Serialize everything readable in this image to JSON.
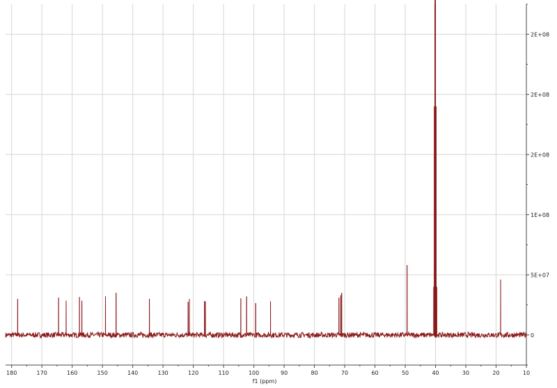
{
  "chart_data": {
    "type": "line",
    "title": "",
    "xlabel": "f1 (ppm)",
    "ylabel": "",
    "xlim": [
      182,
      10
    ],
    "ylim": [
      -25000000,
      275000000
    ],
    "x_reversed": true,
    "grid": true,
    "x_ticks": [
      180,
      170,
      160,
      150,
      140,
      130,
      120,
      110,
      100,
      90,
      80,
      70,
      60,
      50,
      40,
      30,
      20,
      10
    ],
    "y_ticks": [
      {
        "value": 0,
        "label": "0"
      },
      {
        "value": 50000000,
        "label": "5E+07"
      },
      {
        "value": 100000000,
        "label": "1E+08"
      },
      {
        "value": 150000000,
        "label": "2E+08"
      },
      {
        "value": 200000000,
        "label": "2E+08"
      },
      {
        "value": 250000000,
        "label": "2E+08"
      }
    ],
    "line_color": "#8b1a1a",
    "series": [
      {
        "peaks": [
          {
            "x": 178.0,
            "y": 30000000
          },
          {
            "x": 164.5,
            "y": 31000000
          },
          {
            "x": 162.0,
            "y": 28500000
          },
          {
            "x": 157.6,
            "y": 31500000
          },
          {
            "x": 156.8,
            "y": 28500000
          },
          {
            "x": 149.0,
            "y": 32000000
          },
          {
            "x": 145.5,
            "y": 35000000
          },
          {
            "x": 134.5,
            "y": 30000000
          },
          {
            "x": 121.7,
            "y": 27500000
          },
          {
            "x": 121.3,
            "y": 30000000
          },
          {
            "x": 116.3,
            "y": 28000000
          },
          {
            "x": 116.0,
            "y": 28000000
          },
          {
            "x": 104.3,
            "y": 30500000
          },
          {
            "x": 102.4,
            "y": 32000000
          },
          {
            "x": 99.4,
            "y": 26500000
          },
          {
            "x": 94.5,
            "y": 28000000
          },
          {
            "x": 71.9,
            "y": 31000000
          },
          {
            "x": 71.3,
            "y": 33000000
          },
          {
            "x": 71.0,
            "y": 35000000
          },
          {
            "x": 49.4,
            "y": 58000000
          },
          {
            "x": 40.6,
            "y": 40000000
          },
          {
            "x": 40.4,
            "y": 190000000
          },
          {
            "x": 40.2,
            "y": 280000000
          },
          {
            "x": 40.0,
            "y": 280000000
          },
          {
            "x": 39.8,
            "y": 190000000
          },
          {
            "x": 39.6,
            "y": 40000000
          },
          {
            "x": 18.5,
            "y": 46000000
          }
        ],
        "noise_amplitude": 2200000
      }
    ]
  }
}
